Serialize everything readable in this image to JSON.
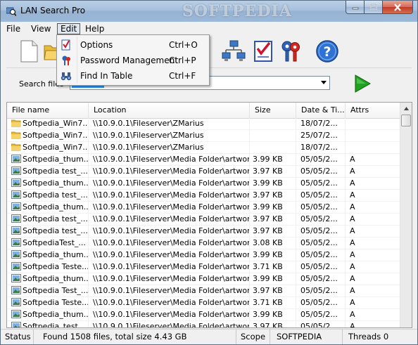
{
  "window": {
    "title": "LAN Search Pro",
    "watermark": "SOFTPEDIA"
  },
  "menu": {
    "file": "File",
    "view": "View",
    "edit": "Edit",
    "help": "Help"
  },
  "edit_menu": {
    "items": [
      {
        "label": "Options",
        "shortcut": "Ctrl+O",
        "icon": "options-checklist-icon"
      },
      {
        "label": "Password Management",
        "shortcut": "Ctrl+P",
        "icon": "password-keys-icon"
      },
      {
        "label": "Find In Table",
        "shortcut": "Ctrl+F",
        "icon": "binoculars-icon"
      }
    ]
  },
  "toolbar": {
    "icons": [
      "new-document-icon",
      "open-folder-icon",
      "network-computers-icon",
      "checklist-icon",
      "keys-icon",
      "help-icon"
    ]
  },
  "search": {
    "label": "Search files",
    "go_icon": "play-arrow-icon"
  },
  "table": {
    "columns": [
      "File name",
      "Location",
      "Size",
      "Date & Ti...",
      "Attrs"
    ],
    "rows": [
      {
        "type": "folder",
        "name": "Softpedia_Win7...",
        "location": "\\\\10.9.0.1\\Fileserver\\ZMarius",
        "size": "",
        "date": "18/07/2...",
        "attrs": ""
      },
      {
        "type": "folder",
        "name": "Softpedia_Win7...",
        "location": "\\\\10.9.0.1\\Fileserver\\ZMarius",
        "size": "",
        "date": "25/07/2...",
        "attrs": ""
      },
      {
        "type": "folder",
        "name": "Softpedia_Win7...",
        "location": "\\\\10.9.0.1\\Fileserver\\ZMarius",
        "size": "",
        "date": "18/07/2...",
        "attrs": ""
      },
      {
        "type": "image",
        "name": "Softpedia_thum...",
        "location": "\\\\10.9.0.1\\Fileserver\\Media Folder\\artwork",
        "size": "3.99 KB",
        "date": "05/05/2...",
        "attrs": "A"
      },
      {
        "type": "image",
        "name": "Softpedia test_...",
        "location": "\\\\10.9.0.1\\Fileserver\\Media Folder\\artwork",
        "size": "3.97 KB",
        "date": "05/05/2...",
        "attrs": "A"
      },
      {
        "type": "image",
        "name": "Softpedia_thum...",
        "location": "\\\\10.9.0.1\\Fileserver\\Media Folder\\artwork",
        "size": "3.99 KB",
        "date": "05/05/2...",
        "attrs": "A"
      },
      {
        "type": "image",
        "name": "Softpedia test_...",
        "location": "\\\\10.9.0.1\\Fileserver\\Media Folder\\artwork",
        "size": "3.97 KB",
        "date": "05/05/2...",
        "attrs": "A"
      },
      {
        "type": "image",
        "name": "Softpedia_thum...",
        "location": "\\\\10.9.0.1\\Fileserver\\Media Folder\\artwork",
        "size": "3.99 KB",
        "date": "05/05/2...",
        "attrs": "A"
      },
      {
        "type": "image",
        "name": "Softpedia test_...",
        "location": "\\\\10.9.0.1\\Fileserver\\Media Folder\\artwork",
        "size": "3.97 KB",
        "date": "05/05/2...",
        "attrs": "A"
      },
      {
        "type": "image",
        "name": "Softpedia test_...",
        "location": "\\\\10.9.0.1\\Fileserver\\Media Folder\\artwork",
        "size": "3.97 KB",
        "date": "05/05/2...",
        "attrs": "A"
      },
      {
        "type": "image",
        "name": "SoftpediaTest_...",
        "location": "\\\\10.9.0.1\\Fileserver\\Media Folder\\artwork",
        "size": "3.08 KB",
        "date": "05/05/2...",
        "attrs": "A"
      },
      {
        "type": "image",
        "name": "Softpedia_thum...",
        "location": "\\\\10.9.0.1\\Fileserver\\Media Folder\\artwork",
        "size": "3.99 KB",
        "date": "05/05/2...",
        "attrs": "A"
      },
      {
        "type": "image",
        "name": "Softpedia Teste...",
        "location": "\\\\10.9.0.1\\Fileserver\\Media Folder\\artwork",
        "size": "3.71 KB",
        "date": "05/05/2...",
        "attrs": "A"
      },
      {
        "type": "image",
        "name": "Softpedia_thum...",
        "location": "\\\\10.9.0.1\\Fileserver\\Media Folder\\artwork",
        "size": "3.99 KB",
        "date": "05/05/2...",
        "attrs": "A"
      },
      {
        "type": "image",
        "name": "Softpedia Test_...",
        "location": "\\\\10.9.0.1\\Fileserver\\Media Folder\\artwork",
        "size": "3.97 KB",
        "date": "05/05/2...",
        "attrs": "A"
      },
      {
        "type": "image",
        "name": "Softpedia Teste...",
        "location": "\\\\10.9.0.1\\Fileserver\\Media Folder\\artwork",
        "size": "3.71 KB",
        "date": "05/05/2...",
        "attrs": "A"
      },
      {
        "type": "image",
        "name": "Softpedia_thum...",
        "location": "\\\\10.9.0.1\\Fileserver\\Media Folder\\artwork",
        "size": "3.99 KB",
        "date": "05/05/2...",
        "attrs": "A"
      },
      {
        "type": "image",
        "name": "Softpedia_test...",
        "location": "\\\\10.9.0.1\\Fileserver\\Media Folder\\artwork",
        "size": "3.97 KB",
        "date": "05/05/2...",
        "attrs": "A"
      }
    ]
  },
  "status": {
    "label": "Status",
    "found": "Found 1508 files, total size 4.43 GB",
    "scope_label": "Scope",
    "scope_value": "SOFTPEDIA",
    "threads": "Threads  0"
  }
}
